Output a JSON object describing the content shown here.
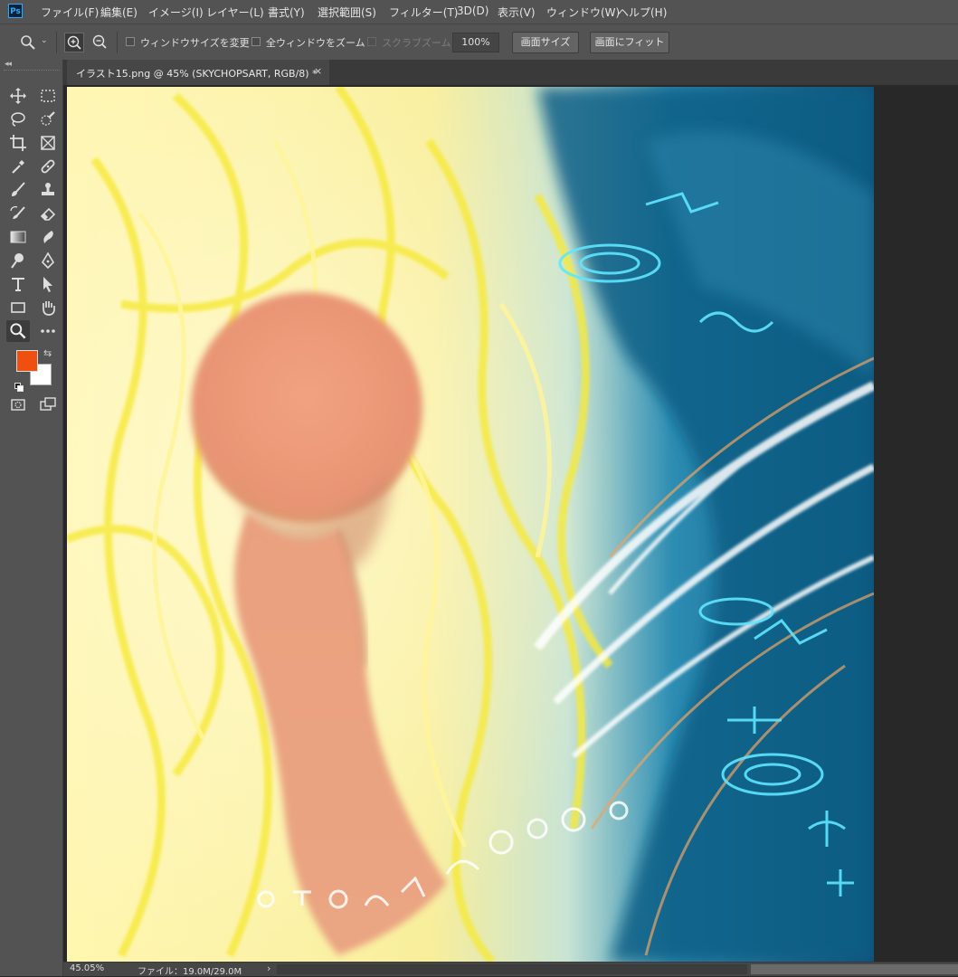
{
  "app": {
    "logo_text": "Ps"
  },
  "menu": {
    "items": [
      "ファイル(F)",
      "編集(E)",
      "イメージ(I)",
      "レイヤー(L)",
      "書式(Y)",
      "選択範囲(S)",
      "フィルター(T)",
      "3D(D)",
      "表示(V)",
      "ウィンドウ(W)",
      "ヘルプ(H)"
    ]
  },
  "options": {
    "resize_windows_label": "ウィンドウサイズを変更",
    "zoom_all_label": "全ウィンドウをズーム",
    "scrubby_zoom_label": "スクラブズーム",
    "zoom_value": "100%",
    "fill_screen_label": "画面サイズ",
    "fit_screen_label": "画面にフィット"
  },
  "colors": {
    "foreground": "#f0500f",
    "background": "#ffffff",
    "accent": "#31a8ff"
  },
  "document": {
    "tab_title": "イラスト15.png @ 45% (SKYCHOPSART, RGB/8) *",
    "close_glyph": "×"
  },
  "status": {
    "zoom": "45.05%",
    "file_info": "ファイル：19.0M/29.0M",
    "expand_glyph": "›",
    "scroll_left_glyph": "‹"
  }
}
